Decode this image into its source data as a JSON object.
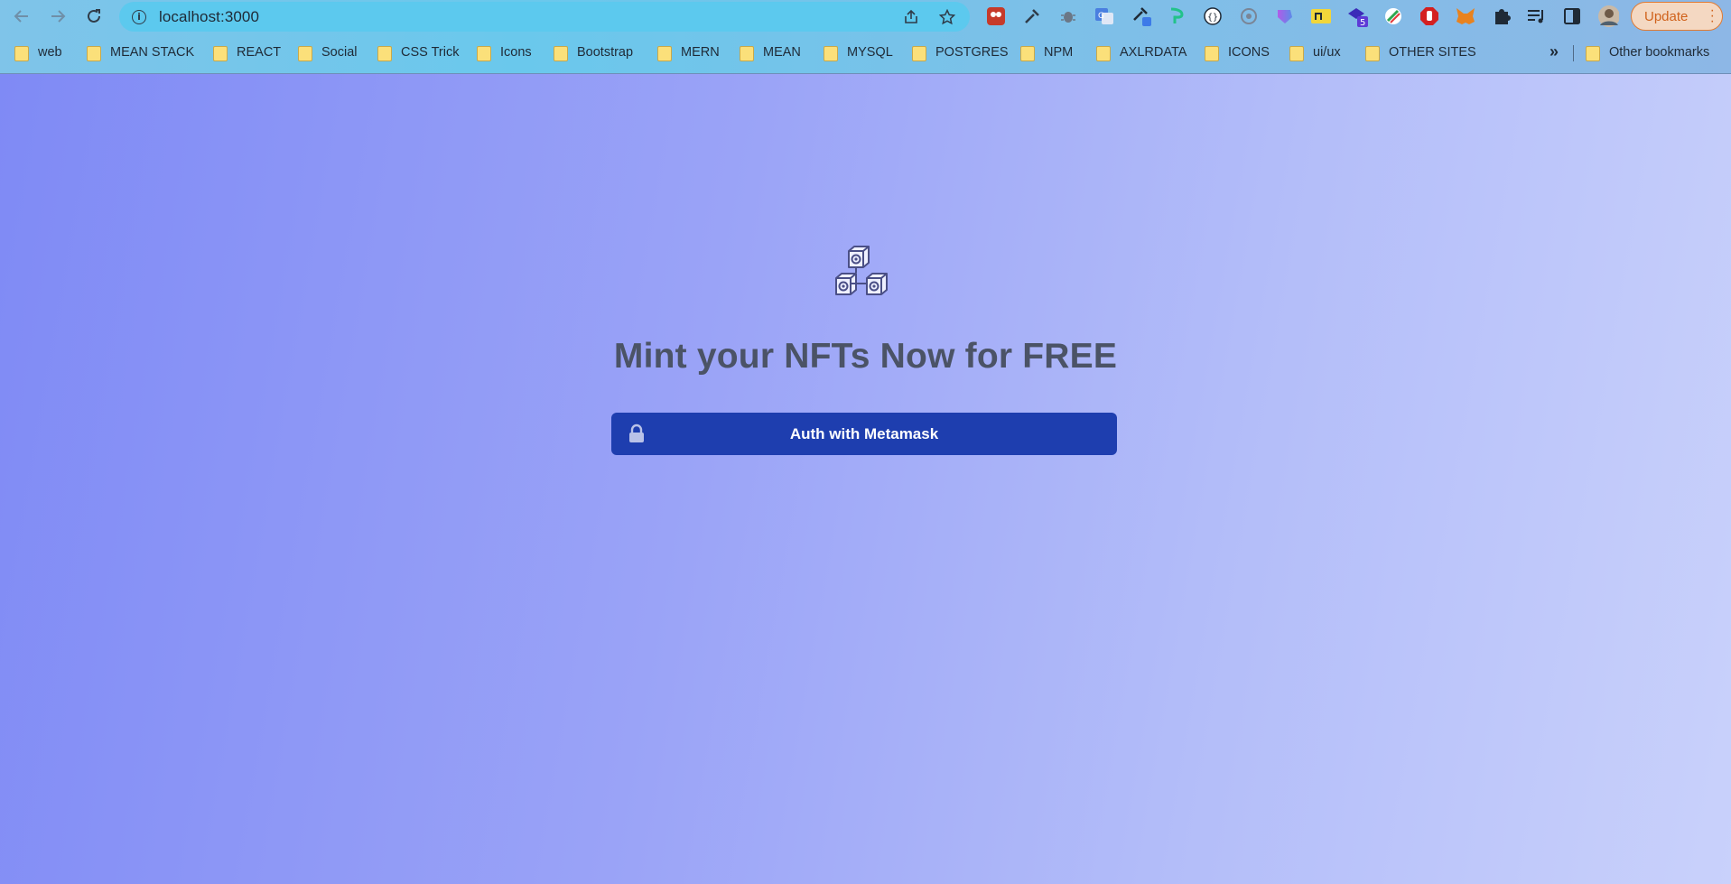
{
  "browser": {
    "url": "localhost:3000",
    "update_label": "Update",
    "bookmarks": [
      "web",
      "MEAN STACK",
      "REACT",
      "Social",
      "CSS Trick",
      "Icons",
      "Bootstrap",
      "MERN",
      "MEAN",
      "MYSQL",
      "POSTGRES",
      "NPM",
      "AXLRDATA",
      "ICONS",
      "ui/ux",
      "OTHER SITES"
    ],
    "other_bookmarks": "Other bookmarks",
    "extension_badge": "5",
    "colors": {
      "update_accent": "#d0621c"
    }
  },
  "page": {
    "headline": "Mint your NFTs Now for FREE",
    "auth_button_label": "Auth with Metamask",
    "colors": {
      "button": "#1e3eaf",
      "headline": "#4b5366",
      "bg_start": "#7f8af5",
      "bg_end": "#c9d1fb"
    }
  }
}
